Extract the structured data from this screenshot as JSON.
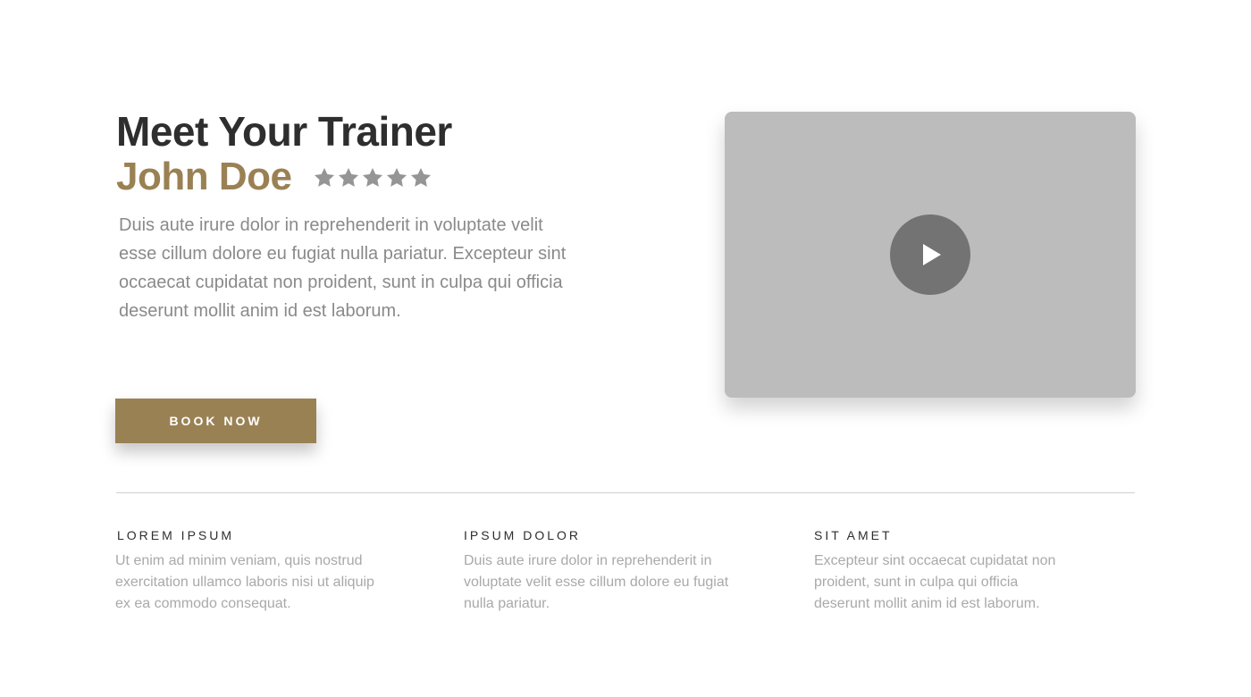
{
  "hero": {
    "heading": "Meet Your Trainer",
    "trainer_name": "John Doe",
    "rating": 5,
    "rating_max": 5,
    "bio": "Duis aute irure dolor in reprehenderit in voluptate velit esse cillum dolore eu fugiat nulla pariatur. Excepteur sint occaecat cupidatat non proident, sunt in culpa qui officia deserunt mollit anim id est laborum.",
    "book_button_label": "BOOK NOW"
  },
  "video": {
    "play_icon": "play-icon"
  },
  "features": [
    {
      "title": "LOREM IPSUM",
      "text": "Ut enim ad minim veniam, quis nostrud exercitation ullamco laboris nisi ut aliquip ex ea commodo consequat."
    },
    {
      "title": "IPSUM DOLOR",
      "text": "Duis aute irure dolor in reprehenderit in voluptate velit esse cillum dolore eu fugiat nulla pariatur."
    },
    {
      "title": "SIT AMET",
      "text": "Excepteur sint occaecat cupidatat non proident, sunt in culpa qui officia deserunt mollit anim id est laborum."
    }
  ],
  "colors": {
    "accent": "#9a8154",
    "heading": "#2e2e2e",
    "body_text": "#8a8a8a",
    "star": "#959595",
    "video_bg": "#bcbcbc",
    "play_bg": "#737373"
  }
}
